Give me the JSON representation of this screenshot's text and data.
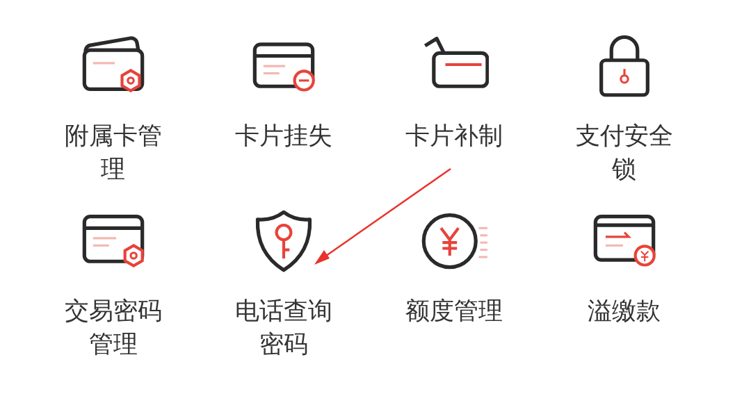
{
  "items": [
    {
      "label": "附属卡管理"
    },
    {
      "label": "卡片挂失"
    },
    {
      "label": "卡片补制"
    },
    {
      "label": "支付安全锁"
    },
    {
      "label": "交易密码管理"
    },
    {
      "label": "电话查询密码"
    },
    {
      "label": "额度管理"
    },
    {
      "label": "溢缴款"
    }
  ]
}
